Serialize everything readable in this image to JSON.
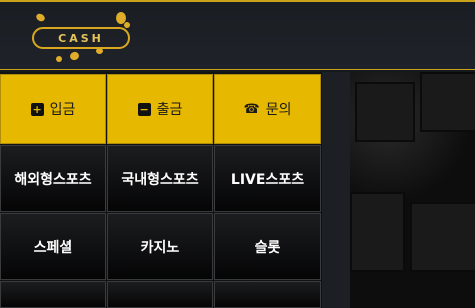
{
  "brand": {
    "logo_text": "CASH"
  },
  "actions": [
    {
      "label": "입금",
      "icon": "plus-square-icon"
    },
    {
      "label": "출금",
      "icon": "minus-square-icon"
    },
    {
      "label": "문의",
      "icon": "phone-icon"
    }
  ],
  "menu": [
    {
      "label": "해외형스포츠"
    },
    {
      "label": "국내형스포츠"
    },
    {
      "label": "LIVE스포츠"
    },
    {
      "label": "스페셜"
    },
    {
      "label": "카지노"
    },
    {
      "label": "슬롯"
    }
  ],
  "colors": {
    "accent": "#e6b800",
    "header_bg": "#1f2329",
    "cell_bg": "#0b0b0c"
  }
}
